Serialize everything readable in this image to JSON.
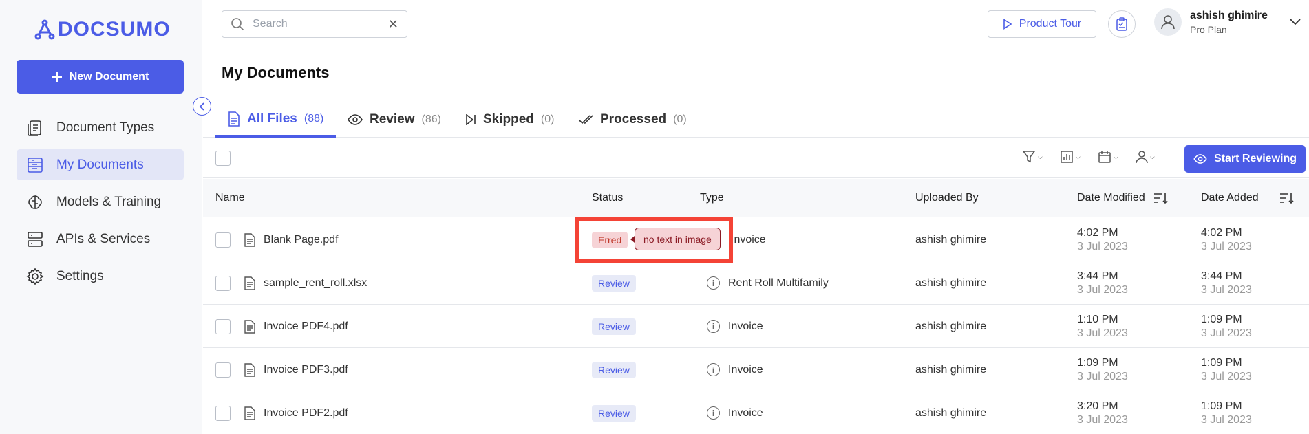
{
  "brand": {
    "name": "DOCSUMO"
  },
  "sidebar": {
    "new_document": "New Document",
    "items": [
      {
        "label": "Document Types",
        "icon": "document-types-icon"
      },
      {
        "label": "My Documents",
        "icon": "my-documents-icon"
      },
      {
        "label": "Models & Training",
        "icon": "brain-icon"
      },
      {
        "label": "APIs & Services",
        "icon": "server-icon"
      },
      {
        "label": "Settings",
        "icon": "gear-icon"
      }
    ]
  },
  "header": {
    "search_placeholder": "Search",
    "product_tour": "Product Tour",
    "user_name": "ashish ghimire",
    "user_plan": "Pro Plan"
  },
  "page": {
    "title": "My Documents"
  },
  "tabs": [
    {
      "label": "All Files",
      "count": "(88)"
    },
    {
      "label": "Review",
      "count": "(86)"
    },
    {
      "label": "Skipped",
      "count": "(0)"
    },
    {
      "label": "Processed",
      "count": "(0)"
    }
  ],
  "toolbar": {
    "start_reviewing": "Start Reviewing"
  },
  "table": {
    "headers": [
      "Name",
      "Status",
      "Type",
      "Uploaded By",
      "Date Modified",
      "Date Added"
    ],
    "rows": [
      {
        "name": "Blank Page.pdf",
        "status": "Erred",
        "type": "Invoice",
        "uploaded_by": "ashish ghimire",
        "modified_time": "4:02 PM",
        "modified_date": "3 Jul 2023",
        "added_time": "4:02 PM",
        "added_date": "3 Jul 2023"
      },
      {
        "name": "sample_rent_roll.xlsx",
        "status": "Review",
        "type": "Rent Roll Multifamily",
        "uploaded_by": "ashish ghimire",
        "modified_time": "3:44 PM",
        "modified_date": "3 Jul 2023",
        "added_time": "3:44 PM",
        "added_date": "3 Jul 2023"
      },
      {
        "name": "Invoice PDF4.pdf",
        "status": "Review",
        "type": "Invoice",
        "uploaded_by": "ashish ghimire",
        "modified_time": "1:10 PM",
        "modified_date": "3 Jul 2023",
        "added_time": "1:09 PM",
        "added_date": "3 Jul 2023"
      },
      {
        "name": "Invoice PDF3.pdf",
        "status": "Review",
        "type": "Invoice",
        "uploaded_by": "ashish ghimire",
        "modified_time": "1:09 PM",
        "modified_date": "3 Jul 2023",
        "added_time": "1:09 PM",
        "added_date": "3 Jul 2023"
      },
      {
        "name": "Invoice PDF2.pdf",
        "status": "Review",
        "type": "Invoice",
        "uploaded_by": "ashish ghimire",
        "modified_time": "3:20 PM",
        "modified_date": "3 Jul 2023",
        "added_time": "1:09 PM",
        "added_date": "3 Jul 2023"
      }
    ]
  },
  "tooltip": {
    "text": "no text in image"
  },
  "colors": {
    "accent": "#4b5ce6",
    "erred_bg": "#f6d3d6",
    "highlight": "#f44336"
  }
}
